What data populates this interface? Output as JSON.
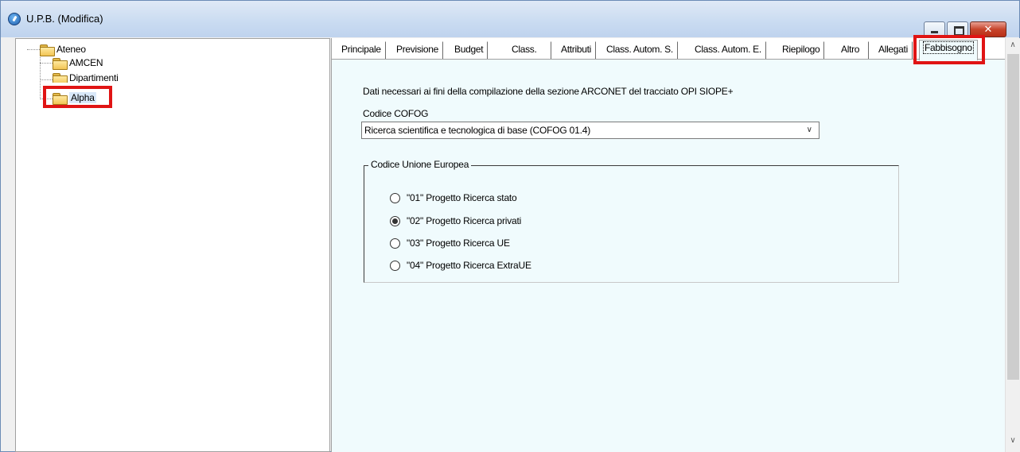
{
  "window": {
    "title": "U.P.B. (Modifica)",
    "icon": "app-icon",
    "controls": {
      "minimize": "minimize-icon",
      "maximize": "maximize-icon",
      "close": "✕"
    }
  },
  "tree": {
    "items": [
      {
        "label": "Ateneo",
        "icon": "folder-icon"
      },
      {
        "label": "AMCEN",
        "icon": "folder-icon"
      },
      {
        "label": "Dipartimenti",
        "icon": "folder-icon"
      },
      {
        "label": "Alpha",
        "icon": "folder-icon",
        "selected": true,
        "highlighted": true
      }
    ]
  },
  "tabs": [
    {
      "label": "Principale"
    },
    {
      "label": "Previsione"
    },
    {
      "label": "Budget"
    },
    {
      "label": "Class."
    },
    {
      "label": "Attributi"
    },
    {
      "label": "Class. Autom. S."
    },
    {
      "label": "Class. Autom. E."
    },
    {
      "label": "Riepilogo"
    },
    {
      "label": "Altro"
    },
    {
      "label": "Allegati"
    },
    {
      "label": "Fabbisogno",
      "active": true,
      "highlighted": true
    }
  ],
  "fabbisogno": {
    "description": "Dati necessari ai fini della compilazione della sezione ARCONET del tracciato OPI SIOPE+",
    "cofog_label": "Codice COFOG",
    "cofog_value": "Ricerca scientifica e tecnologica di base (COFOG 01.4)",
    "ue_group_label": "Codice Unione Europea",
    "ue_options": [
      {
        "label": "\"01\" Progetto Ricerca stato",
        "checked": false
      },
      {
        "label": "\"02\" Progetto Ricerca privati",
        "checked": true
      },
      {
        "label": "\"03\" Progetto Ricerca UE",
        "checked": false
      },
      {
        "label": "\"04\" Progetto Ricerca ExtraUE",
        "checked": false
      }
    ]
  },
  "colors": {
    "highlight": "#e01414",
    "titlebar": "#c9dbf1",
    "content_bg": "#f0fbfd"
  }
}
